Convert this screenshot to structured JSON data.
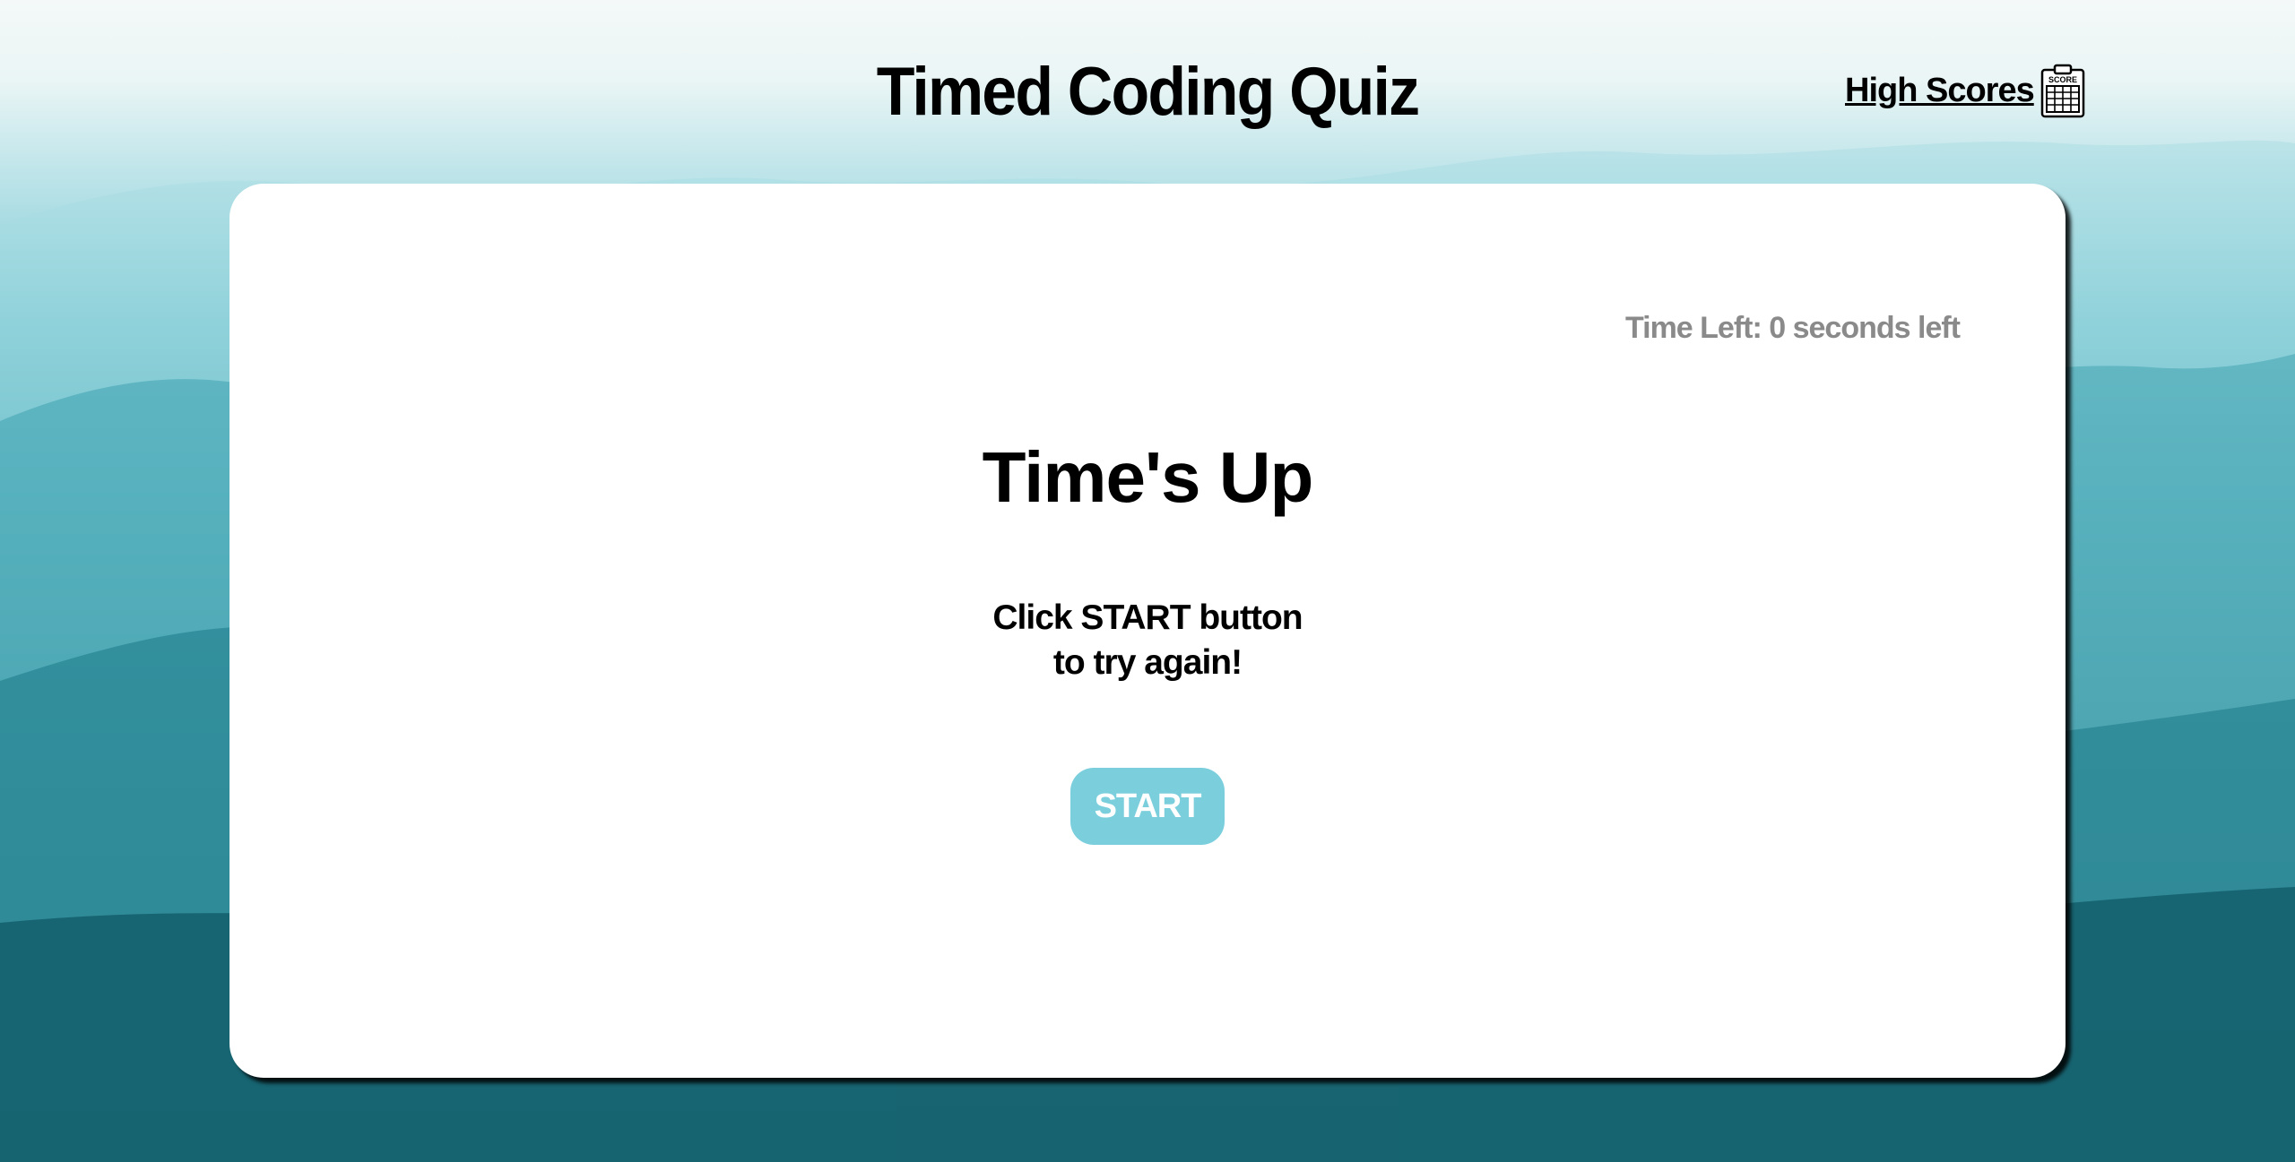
{
  "page": {
    "title": "Timed Coding Quiz"
  },
  "header": {
    "high_scores_label": "High Scores",
    "high_scores_icon": "scoreboard-icon",
    "icon_text": "SCORE"
  },
  "quiz": {
    "timer_text": "Time Left: 0 seconds left",
    "heading": "Time's Up",
    "instructions_line1": "Click START button",
    "instructions_line2": "to try again!",
    "start_label": "START"
  },
  "colors": {
    "start_button": "#7bcfdd",
    "timer_text": "#8a8a8a",
    "card_background": "#ffffff"
  }
}
